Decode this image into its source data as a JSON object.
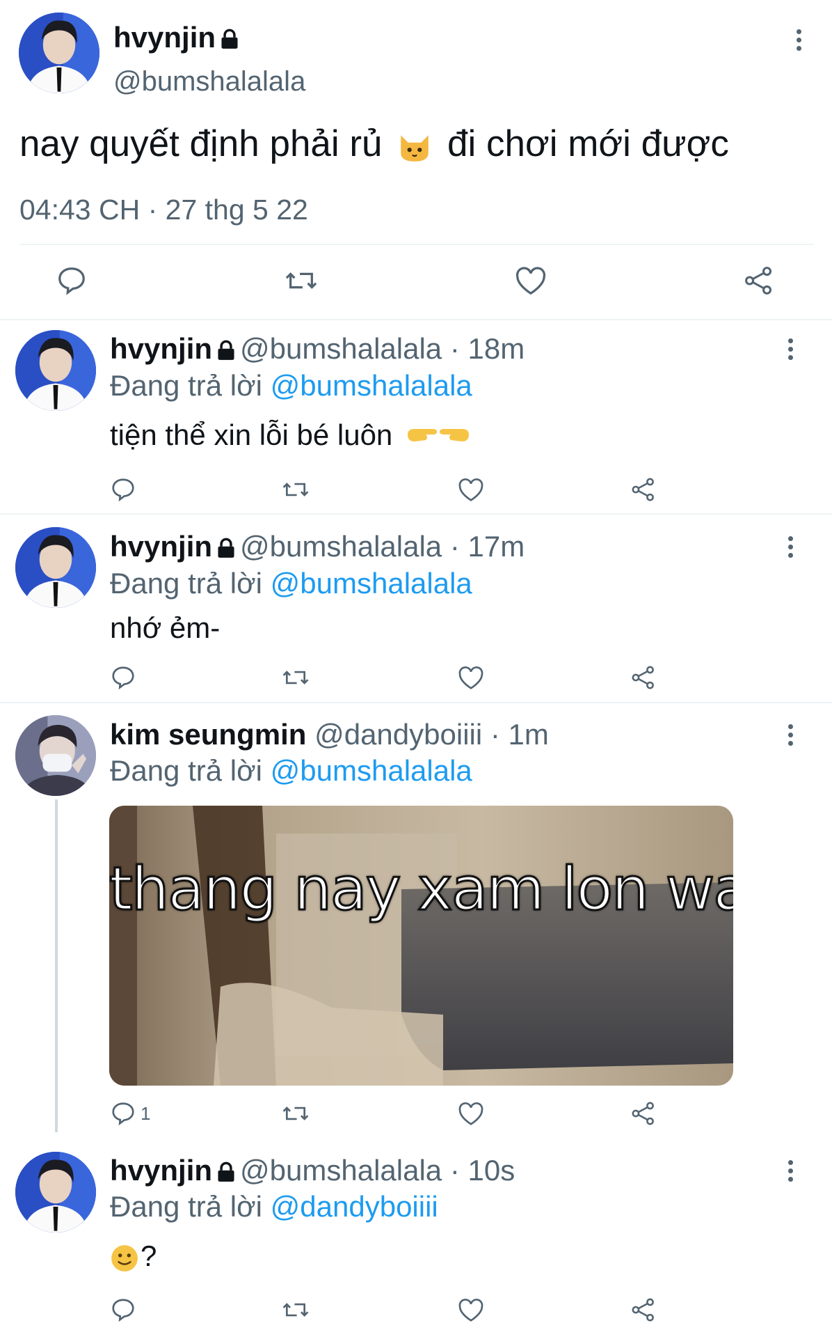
{
  "main_tweet": {
    "display_name": "hvynjin",
    "handle": "@bumshalalala",
    "text_before": "nay quyết định phải rủ",
    "text_after": "đi chơi mới được",
    "timestamp": "04:43 CH · 27 thg 5 22"
  },
  "replies": [
    {
      "display_name": "hvynjin",
      "handle": "@bumshalalala",
      "time": "· 18m",
      "reply_prefix": "Đang trả lời",
      "reply_to": "@bumshalalala",
      "text": "tiện thể xin lỗi bé luôn"
    },
    {
      "display_name": "hvynjin",
      "handle": "@bumshalalala",
      "time": "· 17m",
      "reply_prefix": "Đang trả lời",
      "reply_to": "@bumshalalala",
      "text": "nhớ ẻm-"
    },
    {
      "display_name": "kim seungmin",
      "handle": "@dandyboiiii",
      "time": "· 1m",
      "reply_prefix": "Đang trả lời",
      "reply_to": "@bumshalalala",
      "image_caption": "thang nay xam lon wa",
      "reply_count": "1"
    },
    {
      "display_name": "hvynjin",
      "handle": "@bumshalalala",
      "time": "· 10s",
      "reply_prefix": "Đang trả lời",
      "reply_to": "@dandyboiiii",
      "text": "?"
    }
  ],
  "icons": {
    "reply": "speech-bubble-icon",
    "retweet": "retweet-icon",
    "like": "heart-icon",
    "share": "share-icon",
    "more": "three-dots-vertical-icon",
    "lock": "lock-icon"
  },
  "colors": {
    "accent": "#1d9bf0",
    "secondary_text": "#536471",
    "divider": "#eff3f4"
  }
}
